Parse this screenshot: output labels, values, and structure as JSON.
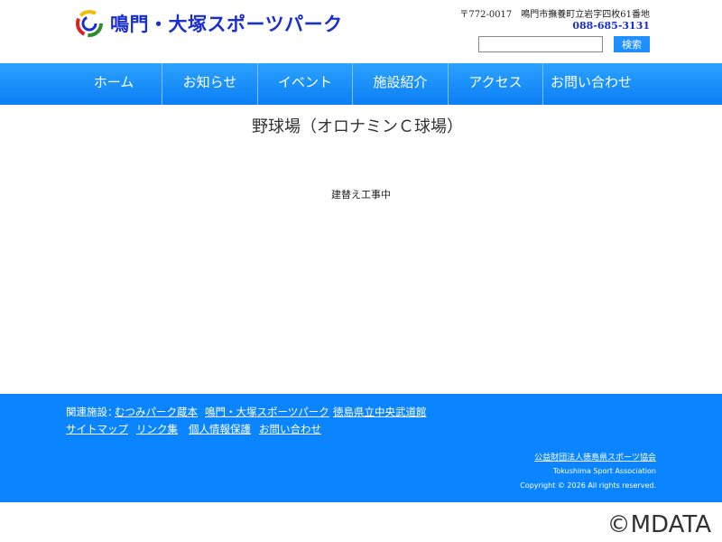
{
  "header": {
    "logo_text": "鳴門・大塚スポーツパーク",
    "address": "〒772-0017　鳴門市撫養町立岩字四枚61番地",
    "tel": "088-685-3131",
    "search": {
      "placeholder": "",
      "button_label": "検索"
    }
  },
  "nav": {
    "items": [
      {
        "label": "ホーム"
      },
      {
        "label": "お知らせ"
      },
      {
        "label": "イベント"
      },
      {
        "label": "施設紹介"
      },
      {
        "label": "アクセス"
      },
      {
        "label": "お問い合わせ"
      }
    ]
  },
  "main": {
    "title": "野球場（オロナミンＣ球場）",
    "notice": "建替え工事中"
  },
  "footer": {
    "related_label": "関連施設：",
    "related_links": [
      "むつみパーク蔵本",
      "鳴門・大塚スポーツパーク",
      "徳島県立中央武道館"
    ],
    "site_links": [
      "サイトマップ",
      "リンク集",
      "個人情報保護",
      "お問い合わせ"
    ],
    "org_name": "公益財団法人徳島県スポーツ協会",
    "org_en": "Tokushima Sport Association",
    "copyright": "Copyright © 2026 All rights reserved."
  },
  "watermark": "©MDATA",
  "colors": {
    "brand_blue": "#1a2fd0",
    "nav_blue": "#0b7ff5",
    "footer_blue": "#0a85ff"
  }
}
